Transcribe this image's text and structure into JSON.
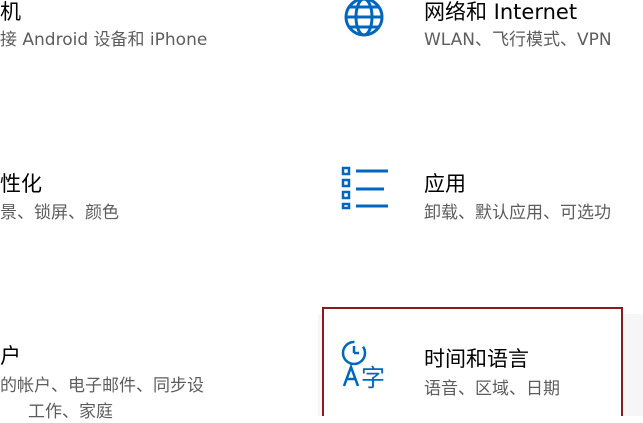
{
  "tiles": {
    "phone": {
      "title": "机",
      "desc": "接 Android 设备和 iPhone"
    },
    "network": {
      "title": "网络和 Internet",
      "desc": "WLAN、飞行模式、VPN",
      "icon": "globe-icon"
    },
    "personalization": {
      "title": "性化",
      "desc": "景、锁屏、颜色"
    },
    "apps": {
      "title": "应用",
      "desc": "卸载、默认应用、可选功",
      "icon": "apps-list-icon"
    },
    "accounts": {
      "title": "户",
      "desc": "的帐户、电子邮件、同步设",
      "desc2": "工作、家庭"
    },
    "time_language": {
      "title": "时间和语言",
      "desc": "语音、区域、日期",
      "icon": "time-language-icon"
    }
  },
  "colors": {
    "accent": "#0067c0",
    "highlight_border": "#8b1a1a"
  }
}
